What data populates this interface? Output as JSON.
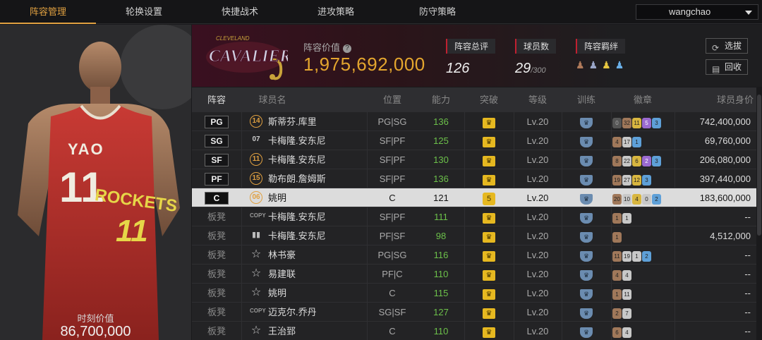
{
  "nav": {
    "tabs": [
      "阵容管理",
      "轮换设置",
      "快捷战术",
      "进攻策略",
      "防守策略"
    ],
    "active": 0,
    "user": "wangchao"
  },
  "left_panel": {
    "jersey_name": "YAO",
    "jersey_number": "11",
    "team_text": "ROCKETS",
    "label": "时刻价值",
    "value": "86,700,000"
  },
  "header": {
    "logo_text": "CAVALIERS",
    "logo_sub": "CLEVELAND",
    "value_label": "阵容价值",
    "value": "1,975,692,000",
    "stats": [
      {
        "label": "阵容总评",
        "value": "126",
        "sub": ""
      },
      {
        "label": "球员数",
        "value": "29",
        "sub": "/300"
      },
      {
        "label": "阵容羁绊",
        "value": "",
        "sub": ""
      }
    ],
    "buttons": [
      "选拔",
      "回收"
    ]
  },
  "table": {
    "columns": [
      "阵容",
      "球员名",
      "位置",
      "能力",
      "突破",
      "等级",
      "训练",
      "徽章",
      "球员身价"
    ],
    "rows": [
      {
        "slot": "PG",
        "bench": false,
        "num": "14",
        "nt": "num",
        "name": "斯蒂芬.库里",
        "pos": "PG|SG",
        "abil": "136",
        "brk": "",
        "lv": "Lv.20",
        "badges": [
          [
            "d",
            "0"
          ],
          [
            "b",
            "32"
          ],
          [
            "g",
            "11"
          ],
          [
            "p",
            "5"
          ],
          [
            "u",
            "3"
          ]
        ],
        "val": "742,400,000"
      },
      {
        "slot": "SG",
        "bench": false,
        "num": "07",
        "nt": "copy",
        "name": "卡梅隆.安东尼",
        "pos": "SF|PF",
        "abil": "125",
        "brk": "",
        "lv": "Lv.20",
        "badges": [
          [
            "b",
            "4"
          ],
          [
            "s",
            "17"
          ],
          [
            "u",
            "1"
          ]
        ],
        "val": "69,760,000"
      },
      {
        "slot": "SF",
        "bench": false,
        "num": "11",
        "nt": "num",
        "name": "卡梅隆.安东尼",
        "pos": "SF|PF",
        "abil": "130",
        "brk": "",
        "lv": "Lv.20",
        "badges": [
          [
            "b",
            "8"
          ],
          [
            "s",
            "22"
          ],
          [
            "g",
            "6"
          ],
          [
            "p",
            "2"
          ],
          [
            "u",
            "3"
          ]
        ],
        "val": "206,080,000"
      },
      {
        "slot": "PF",
        "bench": false,
        "num": "15",
        "nt": "num",
        "name": "勒布朗.詹姆斯",
        "pos": "SF|PF",
        "abil": "136",
        "brk": "",
        "lv": "Lv.20",
        "badges": [
          [
            "b",
            "19"
          ],
          [
            "s",
            "27"
          ],
          [
            "g",
            "12"
          ],
          [
            "u",
            "3"
          ]
        ],
        "val": "397,440,000"
      },
      {
        "slot": "C",
        "bench": false,
        "num": "06",
        "nt": "num",
        "name": "姚明",
        "pos": "C",
        "abil": "121",
        "brk": "5",
        "lv": "Lv.20",
        "badges": [
          [
            "b",
            "20"
          ],
          [
            "s",
            "10"
          ],
          [
            "g",
            "4"
          ],
          [
            "s",
            "0"
          ],
          [
            "u",
            "2"
          ]
        ],
        "val": "183,600,000",
        "selected": true
      },
      {
        "slot": "板凳",
        "bench": true,
        "num": "",
        "nt": "copy",
        "name": "卡梅隆.安东尼",
        "pos": "SF|PF",
        "abil": "111",
        "brk": "",
        "lv": "Lv.20",
        "badges": [
          [
            "b",
            "1"
          ],
          [
            "s",
            "1"
          ]
        ],
        "val": "--"
      },
      {
        "slot": "板凳",
        "bench": true,
        "num": "",
        "nt": "bars",
        "name": "卡梅隆.安东尼",
        "pos": "PF|SF",
        "abil": "98",
        "brk": "",
        "lv": "Lv.20",
        "badges": [
          [
            "b",
            "1"
          ]
        ],
        "val": "4,512,000"
      },
      {
        "slot": "板凳",
        "bench": true,
        "num": "",
        "nt": "star",
        "name": "林书豪",
        "pos": "PG|SG",
        "abil": "116",
        "brk": "",
        "lv": "Lv.20",
        "badges": [
          [
            "b",
            "11"
          ],
          [
            "s",
            "19"
          ],
          [
            "s",
            "1"
          ],
          [
            "u",
            "2"
          ]
        ],
        "val": "--"
      },
      {
        "slot": "板凳",
        "bench": true,
        "num": "",
        "nt": "star",
        "name": "易建联",
        "pos": "PF|C",
        "abil": "110",
        "brk": "",
        "lv": "Lv.20",
        "badges": [
          [
            "b",
            "4"
          ],
          [
            "s",
            "4"
          ]
        ],
        "val": "--"
      },
      {
        "slot": "板凳",
        "bench": true,
        "num": "",
        "nt": "star",
        "name": "姚明",
        "pos": "C",
        "abil": "115",
        "brk": "",
        "lv": "Lv.20",
        "badges": [
          [
            "b",
            "1"
          ],
          [
            "s",
            "11"
          ]
        ],
        "val": "--"
      },
      {
        "slot": "板凳",
        "bench": true,
        "num": "",
        "nt": "copy",
        "name": "迈克尔.乔丹",
        "pos": "SG|SF",
        "abil": "127",
        "brk": "",
        "lv": "Lv.20",
        "badges": [
          [
            "b",
            "2"
          ],
          [
            "s",
            "7"
          ]
        ],
        "val": "--"
      },
      {
        "slot": "板凳",
        "bench": true,
        "num": "",
        "nt": "star",
        "name": "王治郅",
        "pos": "C",
        "abil": "110",
        "brk": "",
        "lv": "Lv.20",
        "badges": [
          [
            "b",
            "6"
          ],
          [
            "s",
            "4"
          ]
        ],
        "val": "--"
      }
    ]
  },
  "colors": {
    "accent": "#e0a040",
    "value_gold": "#e4a62e",
    "ability_green": "#6cc04a",
    "crown": "#e6b820"
  }
}
